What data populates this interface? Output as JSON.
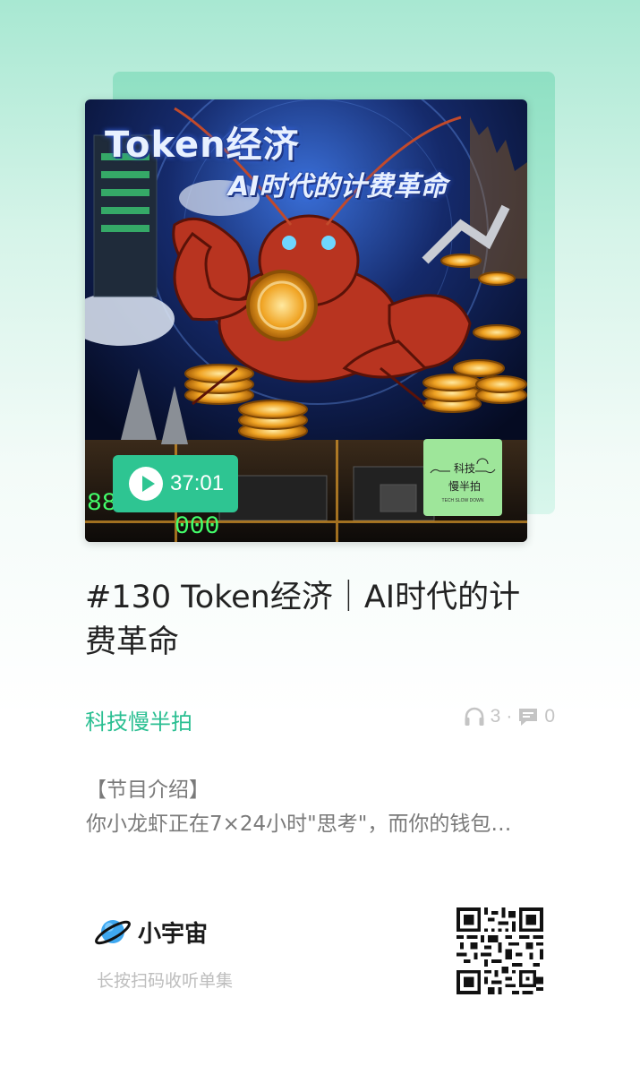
{
  "cover": {
    "title": "Token经济",
    "subtitle": "AI时代的计费革命",
    "duration": "37:01",
    "logo_line1": "科技",
    "logo_line2": "慢半拍",
    "logo_en": "TECH SLOW DOWN"
  },
  "episode": {
    "title": "#130 Token经济｜AI时代的计费革命"
  },
  "podcast": {
    "name": "科技慢半拍"
  },
  "stats": {
    "listens": "3",
    "separator": "·",
    "comments": "0",
    "listen_icon": "headphones-icon",
    "comment_icon": "comment-icon"
  },
  "intro": {
    "heading": "【节目介绍】",
    "text": "你小龙虾正在7×24小时\"思考\"，而你的钱包…"
  },
  "footer": {
    "brand": "小宇宙",
    "scan_hint": "长按扫码收听单集"
  },
  "colors": {
    "accent": "#2ec592",
    "podcast_name": "#2bbf92",
    "logo_bg": "#9ee69a"
  }
}
